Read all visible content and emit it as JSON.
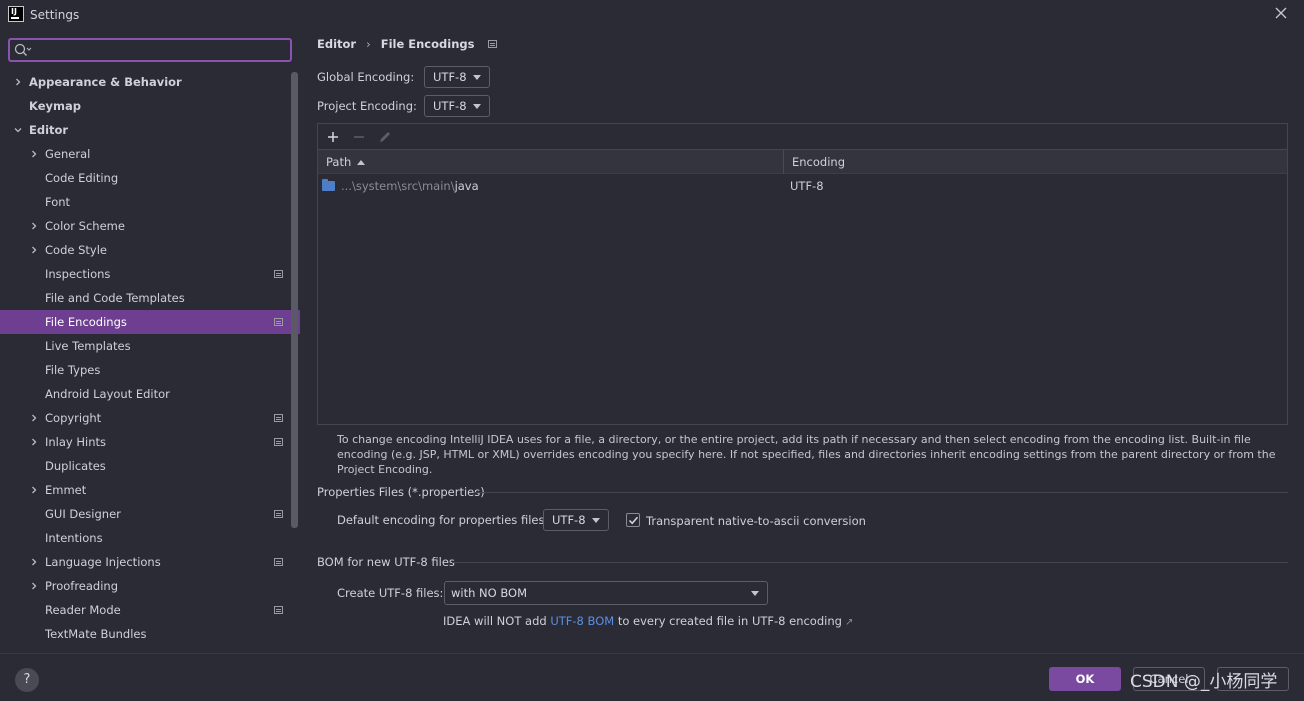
{
  "window": {
    "title": "Settings",
    "logo_text": "IJ"
  },
  "search": {
    "value": "",
    "placeholder": ""
  },
  "sidebar": {
    "items": [
      {
        "label": "Appearance & Behavior",
        "level": 0,
        "arrow": "right",
        "bold": true,
        "pin": false,
        "selected": false
      },
      {
        "label": "Keymap",
        "level": 0,
        "arrow": "none",
        "bold": true,
        "pin": false,
        "selected": false
      },
      {
        "label": "Editor",
        "level": 0,
        "arrow": "down",
        "bold": true,
        "pin": false,
        "selected": false
      },
      {
        "label": "General",
        "level": 1,
        "arrow": "right",
        "bold": false,
        "pin": false,
        "selected": false
      },
      {
        "label": "Code Editing",
        "level": 1,
        "arrow": "none",
        "bold": false,
        "pin": false,
        "selected": false
      },
      {
        "label": "Font",
        "level": 1,
        "arrow": "none",
        "bold": false,
        "pin": false,
        "selected": false
      },
      {
        "label": "Color Scheme",
        "level": 1,
        "arrow": "right",
        "bold": false,
        "pin": false,
        "selected": false
      },
      {
        "label": "Code Style",
        "level": 1,
        "arrow": "right",
        "bold": false,
        "pin": false,
        "selected": false
      },
      {
        "label": "Inspections",
        "level": 1,
        "arrow": "none",
        "bold": false,
        "pin": true,
        "selected": false
      },
      {
        "label": "File and Code Templates",
        "level": 1,
        "arrow": "none",
        "bold": false,
        "pin": false,
        "selected": false
      },
      {
        "label": "File Encodings",
        "level": 1,
        "arrow": "none",
        "bold": false,
        "pin": true,
        "selected": true
      },
      {
        "label": "Live Templates",
        "level": 1,
        "arrow": "none",
        "bold": false,
        "pin": false,
        "selected": false
      },
      {
        "label": "File Types",
        "level": 1,
        "arrow": "none",
        "bold": false,
        "pin": false,
        "selected": false
      },
      {
        "label": "Android Layout Editor",
        "level": 1,
        "arrow": "none",
        "bold": false,
        "pin": false,
        "selected": false
      },
      {
        "label": "Copyright",
        "level": 1,
        "arrow": "right",
        "bold": false,
        "pin": true,
        "selected": false
      },
      {
        "label": "Inlay Hints",
        "level": 1,
        "arrow": "right",
        "bold": false,
        "pin": true,
        "selected": false
      },
      {
        "label": "Duplicates",
        "level": 1,
        "arrow": "none",
        "bold": false,
        "pin": false,
        "selected": false
      },
      {
        "label": "Emmet",
        "level": 1,
        "arrow": "right",
        "bold": false,
        "pin": false,
        "selected": false
      },
      {
        "label": "GUI Designer",
        "level": 1,
        "arrow": "none",
        "bold": false,
        "pin": true,
        "selected": false
      },
      {
        "label": "Intentions",
        "level": 1,
        "arrow": "none",
        "bold": false,
        "pin": false,
        "selected": false
      },
      {
        "label": "Language Injections",
        "level": 1,
        "arrow": "right",
        "bold": false,
        "pin": true,
        "selected": false
      },
      {
        "label": "Proofreading",
        "level": 1,
        "arrow": "right",
        "bold": false,
        "pin": false,
        "selected": false
      },
      {
        "label": "Reader Mode",
        "level": 1,
        "arrow": "none",
        "bold": false,
        "pin": true,
        "selected": false
      },
      {
        "label": "TextMate Bundles",
        "level": 1,
        "arrow": "none",
        "bold": false,
        "pin": false,
        "selected": false
      }
    ]
  },
  "breadcrumb": {
    "parent": "Editor",
    "separator": "›",
    "current": "File Encodings"
  },
  "global_encoding": {
    "label": "Global Encoding:",
    "value": "UTF-8"
  },
  "project_encoding": {
    "label": "Project Encoding:",
    "value": "UTF-8"
  },
  "table": {
    "columns": [
      "Path",
      "Encoding"
    ],
    "rows": [
      {
        "path_prefix": "...\\system\\src\\main\\",
        "path_leaf": "java",
        "encoding": "UTF-8"
      }
    ]
  },
  "hint": {
    "text": "To change encoding IntelliJ IDEA uses for a file, a directory, or the entire project, add its path if necessary and then select encoding from the encoding list. Built-in file encoding (e.g. JSP, HTML or XML) overrides encoding you specify here. If not specified, files and directories inherit encoding settings from the parent directory or from the Project Encoding."
  },
  "properties": {
    "section_title": "Properties Files (*.properties)",
    "default_label": "Default encoding for properties files:",
    "default_value": "UTF-8",
    "checkbox_label": "Transparent native-to-ascii conversion",
    "checkbox_checked": true
  },
  "bom": {
    "section_title": "BOM for new UTF-8 files",
    "create_label": "Create UTF-8 files:",
    "create_value": "with NO BOM",
    "note_prefix": "IDEA will NOT add ",
    "note_link": "UTF-8 BOM",
    "note_suffix": " to every created file in UTF-8 encoding",
    "note_arrow": "↗"
  },
  "buttons": {
    "help": "?",
    "ok": "OK",
    "cancel": "Cancel"
  },
  "watermark": "CSDN @_小杨同学",
  "colors": {
    "accent": "#7a4aa0",
    "selection": "#6e3f91",
    "link": "#5b8fe0"
  }
}
